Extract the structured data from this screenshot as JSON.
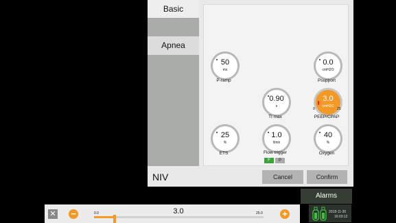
{
  "tabs": {
    "basic": "Basic",
    "apnea": "Apnea"
  },
  "knobs": {
    "p_ramp": {
      "value": "50",
      "unit": "ms",
      "label": "P-ramp"
    },
    "psupport": {
      "value": "0.0",
      "unit": "cmH2O",
      "label": "Psupport"
    },
    "ti_max": {
      "value": "0.90",
      "unit": "s",
      "label": "TI max"
    },
    "peep": {
      "value": "3.0",
      "unit": "cmH2O",
      "label": "PEEP/CPAP",
      "range_min": "0",
      "range_max": "25"
    },
    "ets": {
      "value": "25",
      "unit": "%",
      "label": "ETS"
    },
    "flow_trigger": {
      "value": "1.0",
      "unit": "l/min",
      "label": "Flow trigger",
      "toggle_f": "F",
      "toggle_p": "P"
    },
    "oxygen": {
      "value": "40",
      "unit": "%",
      "label": "Oxygen"
    }
  },
  "mode_label": "NIV",
  "buttons": {
    "cancel": "Cancel",
    "confirm": "Confirm"
  },
  "alarms": {
    "label": "Alarms",
    "date": "2018-11-30",
    "time": "16:03:12"
  },
  "slider": {
    "value": "3.0",
    "min": "0.0",
    "max": "25.0",
    "position": 0.12
  },
  "colors": {
    "accent": "#f39a26",
    "toggle_active": "#37a637"
  },
  "icons": [
    "close-icon",
    "minus-icon",
    "plus-icon",
    "gas-cylinder-icon"
  ]
}
